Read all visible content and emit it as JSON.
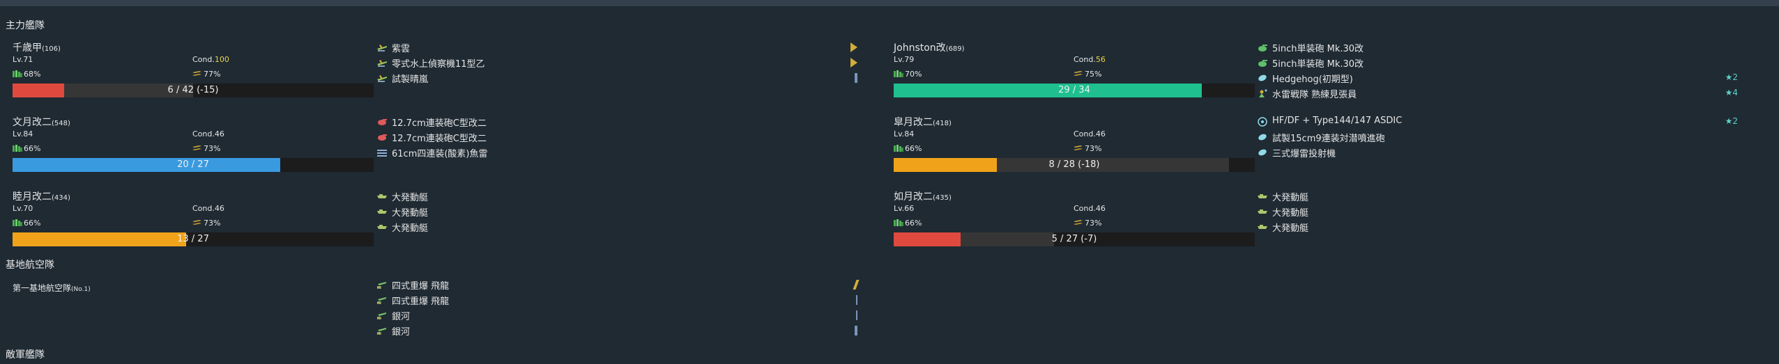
{
  "sections": {
    "main_fleet": "主力艦隊",
    "land_base": "基地航空隊",
    "enemy_fleet": "敵軍艦隊"
  },
  "colors": {
    "hp_red": "#e04a3e",
    "hp_green": "#1fbf8f",
    "hp_blue": "#3a9ae0",
    "hp_orange": "#f0a31a",
    "cond_sparkle": "#e8d24a"
  },
  "ships": [
    {
      "name": "千歳甲",
      "id": "(106)",
      "lv": "Lv.71",
      "cond_label": "Cond.",
      "cond_value": "100",
      "fuel": "68%",
      "ammo": "77%",
      "hp_text": "6 / 42 (-15)",
      "hp_current": 6,
      "hp_max": 42,
      "hp_damage": 15,
      "hp_color": "#e04a3e",
      "equips": [
        {
          "icon": "seaplane-icon",
          "name": "紫雲",
          "indicator": "chevron",
          "star": ""
        },
        {
          "icon": "seaplane-icon",
          "name": "零式水上偵察機11型乙",
          "indicator": "chevron",
          "star": ""
        },
        {
          "icon": "seaplane-icon",
          "name": "試製晴嵐",
          "indicator": "bar",
          "star": ""
        }
      ]
    },
    {
      "name": "Johnston改",
      "id": "(689)",
      "lv": "Lv.79",
      "cond_label": "Cond.",
      "cond_value": "56",
      "fuel": "70%",
      "ammo": "75%",
      "hp_text": "29 / 34",
      "hp_current": 29,
      "hp_max": 34,
      "hp_damage": 0,
      "hp_color": "#1fbf8f",
      "equips": [
        {
          "icon": "main-gun-icon",
          "name": "5inch単装砲 Mk.30改",
          "indicator": "",
          "star": ""
        },
        {
          "icon": "main-gun-icon",
          "name": "5inch単装砲 Mk.30改",
          "indicator": "",
          "star": ""
        },
        {
          "icon": "depth-charge-icon",
          "name": "Hedgehog(初期型)",
          "indicator": "",
          "star": "★2"
        },
        {
          "icon": "lookout-icon",
          "name": "水雷戦隊 熟練見張員",
          "indicator": "",
          "star": "★4"
        }
      ]
    },
    {
      "name": "文月改二",
      "id": "(548)",
      "lv": "Lv.84",
      "cond_label": "Cond.",
      "cond_value": "46",
      "fuel": "66%",
      "ammo": "73%",
      "hp_text": "20 / 27",
      "hp_current": 20,
      "hp_max": 27,
      "hp_damage": 0,
      "hp_color": "#3a9ae0",
      "equips": [
        {
          "icon": "small-gun-icon",
          "name": "12.7cm連装砲C型改二",
          "indicator": "",
          "star": ""
        },
        {
          "icon": "small-gun-icon",
          "name": "12.7cm連装砲C型改二",
          "indicator": "",
          "star": ""
        },
        {
          "icon": "torpedo-icon",
          "name": "61cm四連装(酸素)魚雷",
          "indicator": "",
          "star": ""
        }
      ]
    },
    {
      "name": "皐月改二",
      "id": "(418)",
      "lv": "Lv.84",
      "cond_label": "Cond.",
      "cond_value": "46",
      "fuel": "66%",
      "ammo": "73%",
      "hp_text": "8 / 28 (-18)",
      "hp_current": 8,
      "hp_max": 28,
      "hp_damage": 18,
      "hp_color": "#f0a31a",
      "equips": [
        {
          "icon": "sonar-icon",
          "name": "HF/DF + Type144/147 ASDIC",
          "indicator": "",
          "star": "★2"
        },
        {
          "icon": "depth-charge-icon",
          "name": "試製15cm9連装対潜噴進砲",
          "indicator": "",
          "star": ""
        },
        {
          "icon": "depth-charge-icon",
          "name": "三式爆雷投射機",
          "indicator": "",
          "star": ""
        }
      ]
    },
    {
      "name": "睦月改二",
      "id": "(434)",
      "lv": "Lv.70",
      "cond_label": "Cond.",
      "cond_value": "46",
      "fuel": "66%",
      "ammo": "73%",
      "hp_text": "13 / 27",
      "hp_current": 13,
      "hp_max": 27,
      "hp_damage": 0,
      "hp_color": "#f0a31a",
      "equips": [
        {
          "icon": "landing-craft-icon",
          "name": "大発動艇",
          "indicator": "",
          "star": ""
        },
        {
          "icon": "landing-craft-icon",
          "name": "大発動艇",
          "indicator": "",
          "star": ""
        },
        {
          "icon": "landing-craft-icon",
          "name": "大発動艇",
          "indicator": "",
          "star": ""
        }
      ]
    },
    {
      "name": "如月改二",
      "id": "(435)",
      "lv": "Lv.66",
      "cond_label": "Cond.",
      "cond_value": "46",
      "fuel": "66%",
      "ammo": "73%",
      "hp_text": "5 / 27 (-7)",
      "hp_current": 5,
      "hp_max": 27,
      "hp_damage": 7,
      "hp_color": "#e04a3e",
      "equips": [
        {
          "icon": "landing-craft-icon",
          "name": "大発動艇",
          "indicator": "",
          "star": ""
        },
        {
          "icon": "landing-craft-icon",
          "name": "大発動艇",
          "indicator": "",
          "star": ""
        },
        {
          "icon": "landing-craft-icon",
          "name": "大発動艇",
          "indicator": "",
          "star": ""
        }
      ]
    }
  ],
  "land_base": {
    "name": "第一基地航空隊",
    "id": "(No.1)",
    "equips": [
      {
        "icon": "land-bomber-icon",
        "name": "四式重爆 飛龍",
        "indicator": "slash",
        "star": ""
      },
      {
        "icon": "land-bomber-icon",
        "name": "四式重爆 飛龍",
        "indicator": "thin-bar",
        "star": ""
      },
      {
        "icon": "land-bomber-icon",
        "name": "銀河",
        "indicator": "thin-bar",
        "star": ""
      },
      {
        "icon": "land-bomber-icon",
        "name": "銀河",
        "indicator": "bar",
        "star": ""
      }
    ]
  }
}
